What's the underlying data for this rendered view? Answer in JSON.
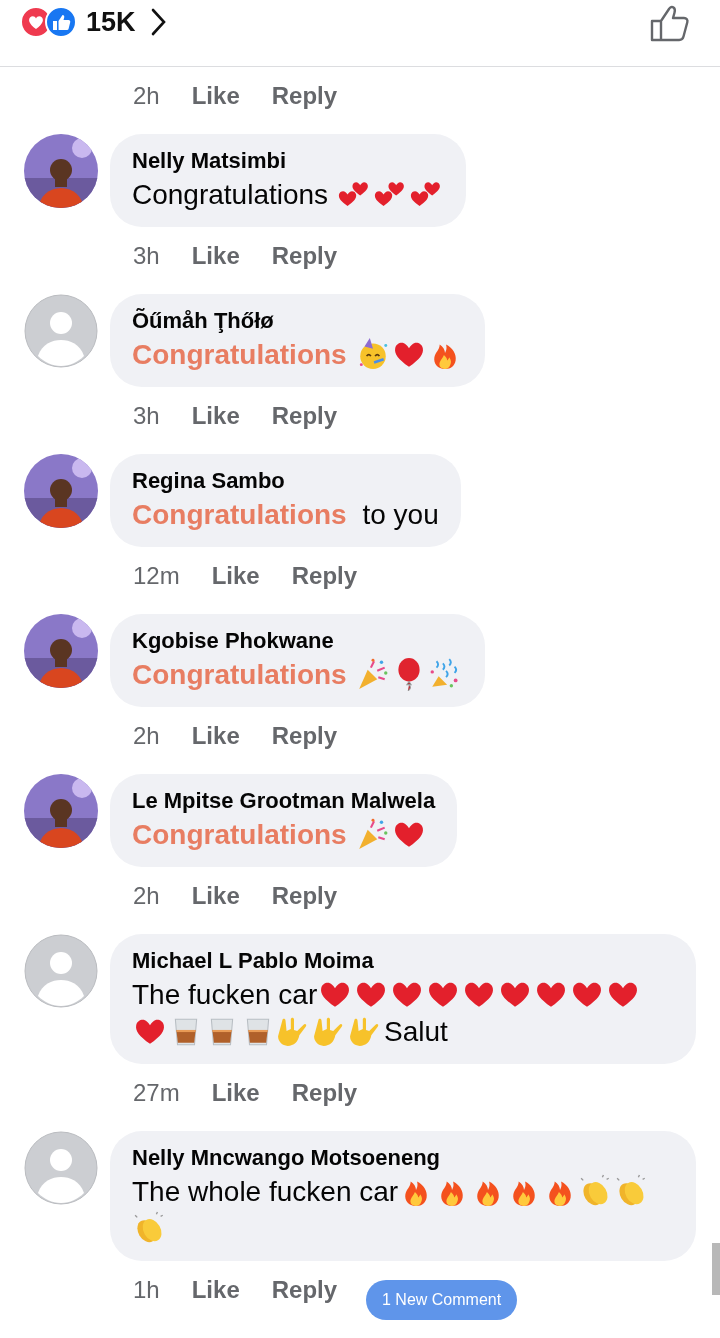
{
  "reactions": {
    "count": "15K"
  },
  "top_meta": {
    "time": "2h",
    "like": "Like",
    "reply": "Reply"
  },
  "comments": [
    {
      "name": "Nelly Matsimbi",
      "avatar": {
        "kind": "picture"
      },
      "message": [
        {
          "kind": "text",
          "text": "Congratulations ",
          "highlighted": false
        },
        {
          "kind": "two-hearts"
        },
        {
          "kind": "two-hearts"
        },
        {
          "kind": "two-hearts"
        }
      ],
      "time": "3h",
      "like": "Like",
      "reply": "Reply"
    },
    {
      "name": "Õűmåh Ţhőłø",
      "avatar": {
        "kind": "default"
      },
      "message": [
        {
          "kind": "text",
          "text": "Congratulations",
          "highlighted": true
        },
        {
          "kind": "party-face"
        },
        {
          "kind": "heart"
        },
        {
          "kind": "fire"
        }
      ],
      "time": "3h",
      "like": "Like",
      "reply": "Reply"
    },
    {
      "name": "Regina Sambo",
      "avatar": {
        "kind": "picture"
      },
      "message": [
        {
          "kind": "text",
          "text": "Congratulations",
          "highlighted": true
        },
        {
          "kind": "text",
          "text": " to you",
          "highlighted": false
        }
      ],
      "time": "12m",
      "like": "Like",
      "reply": "Reply"
    },
    {
      "name": "Kgobise Phokwane",
      "avatar": {
        "kind": "picture"
      },
      "message": [
        {
          "kind": "text",
          "text": "Congratulations",
          "highlighted": true
        },
        {
          "kind": "party-popper"
        },
        {
          "kind": "balloon"
        },
        {
          "kind": "confetti"
        }
      ],
      "time": "2h",
      "like": "Like",
      "reply": "Reply"
    },
    {
      "name": "Le Mpitse Grootman Malwela",
      "avatar": {
        "kind": "picture"
      },
      "message": [
        {
          "kind": "text",
          "text": "Congratulations",
          "highlighted": true
        },
        {
          "kind": "party-popper"
        },
        {
          "kind": "heart"
        }
      ],
      "time": "2h",
      "like": "Like",
      "reply": "Reply"
    },
    {
      "name": "Michael L Pablo Moima",
      "avatar": {
        "kind": "default"
      },
      "message": [
        {
          "kind": "text",
          "text": "The fucken car",
          "highlighted": false
        },
        {
          "kind": "heart"
        },
        {
          "kind": "heart"
        },
        {
          "kind": "heart"
        },
        {
          "kind": "heart"
        },
        {
          "kind": "heart"
        },
        {
          "kind": "heart"
        },
        {
          "kind": "heart"
        },
        {
          "kind": "heart"
        },
        {
          "kind": "heart"
        },
        {
          "kind": "heart"
        },
        {
          "kind": "glass"
        },
        {
          "kind": "glass"
        },
        {
          "kind": "glass"
        },
        {
          "kind": "rock-hand"
        },
        {
          "kind": "rock-hand"
        },
        {
          "kind": "rock-hand"
        },
        {
          "kind": "text",
          "text": "Salut",
          "highlighted": false
        }
      ],
      "time": "27m",
      "like": "Like",
      "reply": "Reply"
    },
    {
      "name": "Nelly Mncwango Motsoeneng",
      "avatar": {
        "kind": "default"
      },
      "message": [
        {
          "kind": "text",
          "text": "The whole fucken car",
          "highlighted": false
        },
        {
          "kind": "fire"
        },
        {
          "kind": "fire"
        },
        {
          "kind": "fire"
        },
        {
          "kind": "fire"
        },
        {
          "kind": "fire"
        },
        {
          "kind": "clap"
        },
        {
          "kind": "clap"
        },
        {
          "kind": "clap"
        }
      ],
      "time": "1h",
      "like": "Like",
      "reply": "Reply"
    }
  ],
  "new_comment_pill": {
    "label": "1 New Comment"
  }
}
